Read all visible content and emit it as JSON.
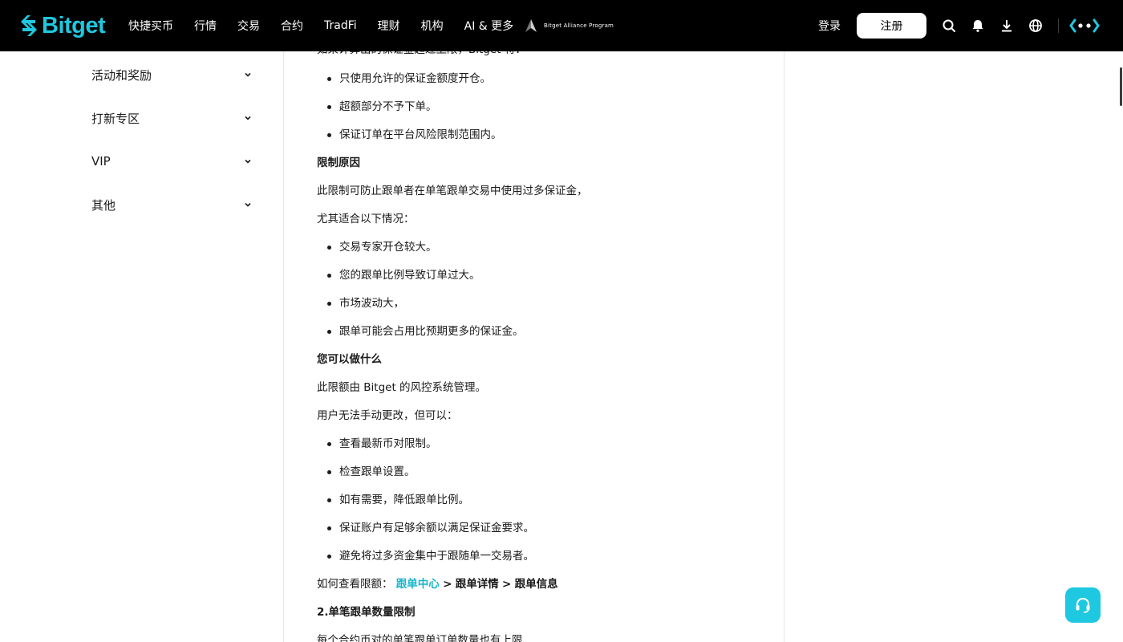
{
  "brand": {
    "name": "Bitget",
    "accent": "#1ec8e0"
  },
  "nav": {
    "items": [
      "快捷买币",
      "行情",
      "交易",
      "合约",
      "TradFi",
      "理财",
      "机构",
      "AI & 更多"
    ],
    "alliance": "Bitget Alliance Program"
  },
  "header": {
    "login": "登录",
    "register": "注册",
    "icons": [
      "search-icon",
      "bell-icon",
      "download-icon",
      "globe-icon",
      "ai-assistant-icon"
    ]
  },
  "sidebar": {
    "items": [
      "活动和奖励",
      "打新专区",
      "VIP",
      "其他"
    ]
  },
  "article": {
    "intro": "如果计算出的保证金超过上限，Bitget 将：",
    "limit_actions": [
      "只使用允许的保证金额度开仓。",
      "超额部分不予下单。",
      "保证订单在平台风险限制范围内。"
    ],
    "reason_heading": "限制原因",
    "reason_p1": "此限制可防止跟单者在单笔跟单交易中使用过多保证金，",
    "reason_p2": "尤其适合以下情况：",
    "reasons": [
      "交易专家开仓较大。",
      "您的跟单比例导致订单过大。",
      "市场波动大，",
      "跟单可能会占用比预期更多的保证金。"
    ],
    "todo_heading": "您可以做什么",
    "todo_p1": "此限额由 Bitget 的风控系统管理。",
    "todo_p2": "用户无法手动更改，但可以：",
    "todos": [
      "查看最新币对限制。",
      "检查跟单设置。",
      "如有需要，降低跟单比例。",
      "保证账户有足够余额以满足保证金要求。",
      "避免将过多资金集中于跟随单一交易者。"
    ],
    "howto_prefix": "如何查看限额：",
    "howto_link": "跟单中心",
    "howto_sep": ">",
    "howto_step2": "跟单详情",
    "howto_step3": "跟单信息",
    "section2_heading": "2.单笔跟单数量限制",
    "section2_p1": "每个合约币对的单笔跟单订单数量也有上限"
  },
  "support": {
    "icon": "headset-icon"
  }
}
